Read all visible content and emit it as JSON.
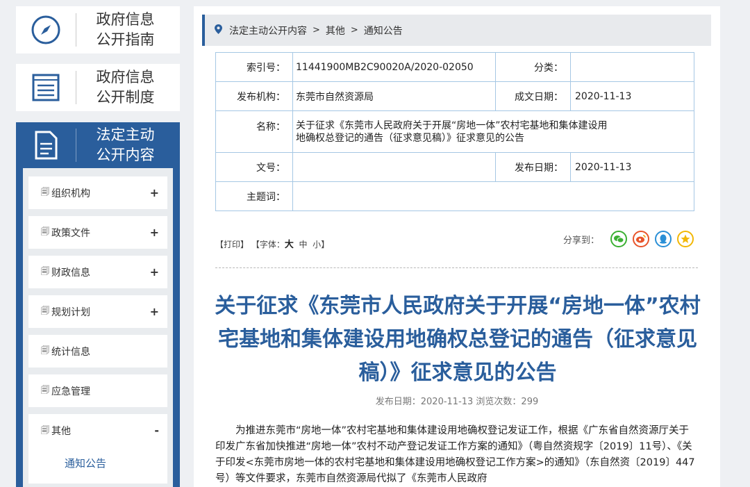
{
  "side_cards": [
    {
      "name": "guide",
      "text": "政府信息公开指南",
      "line1": "政府信息",
      "line2": "公开指南",
      "icon": "compass-icon"
    },
    {
      "name": "system",
      "text": "政府信息公开制度",
      "line1": "政府信息",
      "line2": "公开制度",
      "icon": "list-document-icon"
    },
    {
      "name": "statutory",
      "text": "法定主动公开内容",
      "line1": "法定主动",
      "line2": "公开内容",
      "icon": "document-icon",
      "active": true
    }
  ],
  "menu": [
    {
      "label": "组织机构",
      "sign": "+"
    },
    {
      "label": "政策文件",
      "sign": "+"
    },
    {
      "label": "财政信息",
      "sign": "+"
    },
    {
      "label": "规划计划",
      "sign": "+"
    },
    {
      "label": "统计信息",
      "sign": ""
    },
    {
      "label": "应急管理",
      "sign": ""
    },
    {
      "label": "其他",
      "sign": "-",
      "sub": [
        "通知公告"
      ]
    }
  ],
  "breadcrumb": [
    "法定主动公开内容",
    "其他",
    "通知公告"
  ],
  "meta": {
    "index_label": "索引号：",
    "index_value": "11441900MB2C90020A/2020-02050",
    "category_label": "分类：",
    "category_value": "",
    "issuer_label": "发布机构：",
    "issuer_value": "东莞市自然资源局",
    "created_label": "成文日期：",
    "created_value": "2020-11-13",
    "name_label": "名称：",
    "name_value": "关于征求《东莞市人民政府关于开展“房地一体”农村宅基地和集体建设用地确权总登记的通告（征求意见稿）》征求意见的公告",
    "docno_label": "文号：",
    "docno_value": "",
    "published_label": "发布日期：",
    "published_value": "2020-11-13",
    "subject_label": "主题词：",
    "subject_value": ""
  },
  "tools": {
    "print": "【打印】",
    "font_prefix": "【字体：",
    "font_big": "大",
    "font_mid": "中",
    "font_small": "小",
    "font_suffix": "】"
  },
  "share": {
    "label": "分享到：",
    "icons": [
      "wechat-icon",
      "weibo-icon",
      "qq-icon",
      "qzone-icon"
    ]
  },
  "article": {
    "title": "关于征求《东莞市人民政府关于开展“房地一体”农村宅基地和集体建设用地确权总登记的通告（征求意见稿）》征求意见的公告",
    "pubinfo": "发布日期：2020-11-13  浏览次数：299",
    "body": "为推进东莞市“房地一体”农村宅基地和集体建设用地确权登记发证工作，根据《广东省自然资源厅关于印发广东省加快推进“房地一体”农村不动产登记发证工作方案的通知》（粤自然资规字〔2019〕11号）、《关于印发<东莞市房地一体的农村宅基地和集体建设用地确权登记工作方案>的通知》（东自然资〔2019〕447号）等文件要求，东莞市自然资源局代拟了《东莞市人民政府"
  },
  "colors": {
    "accent": "#2a5e9c",
    "table_border": "#a5c7e4",
    "wechat": "#3bb033",
    "weibo": "#e8542a",
    "qq": "#2a8fd6",
    "qzone": "#f2b705"
  }
}
